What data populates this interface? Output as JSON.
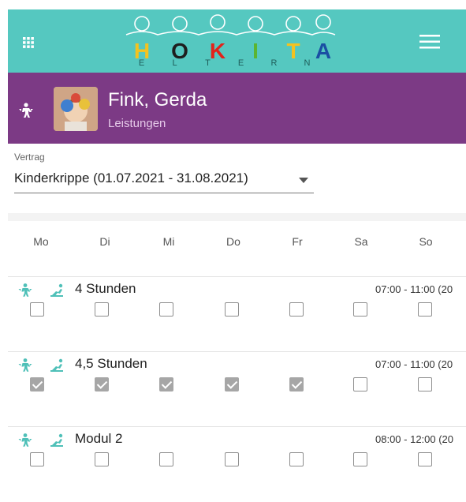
{
  "header": {
    "logo_letters": [
      "H",
      "O",
      "K",
      "I",
      "T",
      "A"
    ],
    "logo_sub": [
      "E",
      "L",
      "T",
      "E",
      "R",
      "N"
    ]
  },
  "user": {
    "name": "Fink, Gerda",
    "section": "Leistungen"
  },
  "contract": {
    "label": "Vertrag",
    "value": "Kinderkrippe (01.07.2021 - 31.08.2021)"
  },
  "weekdays": [
    "Mo",
    "Di",
    "Mi",
    "Do",
    "Fr",
    "Sa",
    "So"
  ],
  "services": [
    {
      "label": "4 Stunden",
      "time": "07:00 - 11:00 (20",
      "checked": [
        false,
        false,
        false,
        false,
        false,
        false,
        false
      ]
    },
    {
      "label": "4,5 Stunden",
      "time": "07:00 - 11:00 (20",
      "checked": [
        true,
        true,
        true,
        true,
        true,
        false,
        false
      ]
    },
    {
      "label": "Modul 2",
      "time": "08:00 - 12:00 (20",
      "checked": [
        false,
        false,
        false,
        false,
        false,
        false,
        false
      ]
    }
  ],
  "colors": {
    "teal": "#55c8c0",
    "purple": "#7c3a85",
    "checked_gray": "#a6a6a6"
  },
  "icons": {
    "grid": "apps-grid-icon",
    "menu": "hamburger-menu-icon",
    "child": "child-care-icon",
    "pickup": "running-child-icon"
  }
}
